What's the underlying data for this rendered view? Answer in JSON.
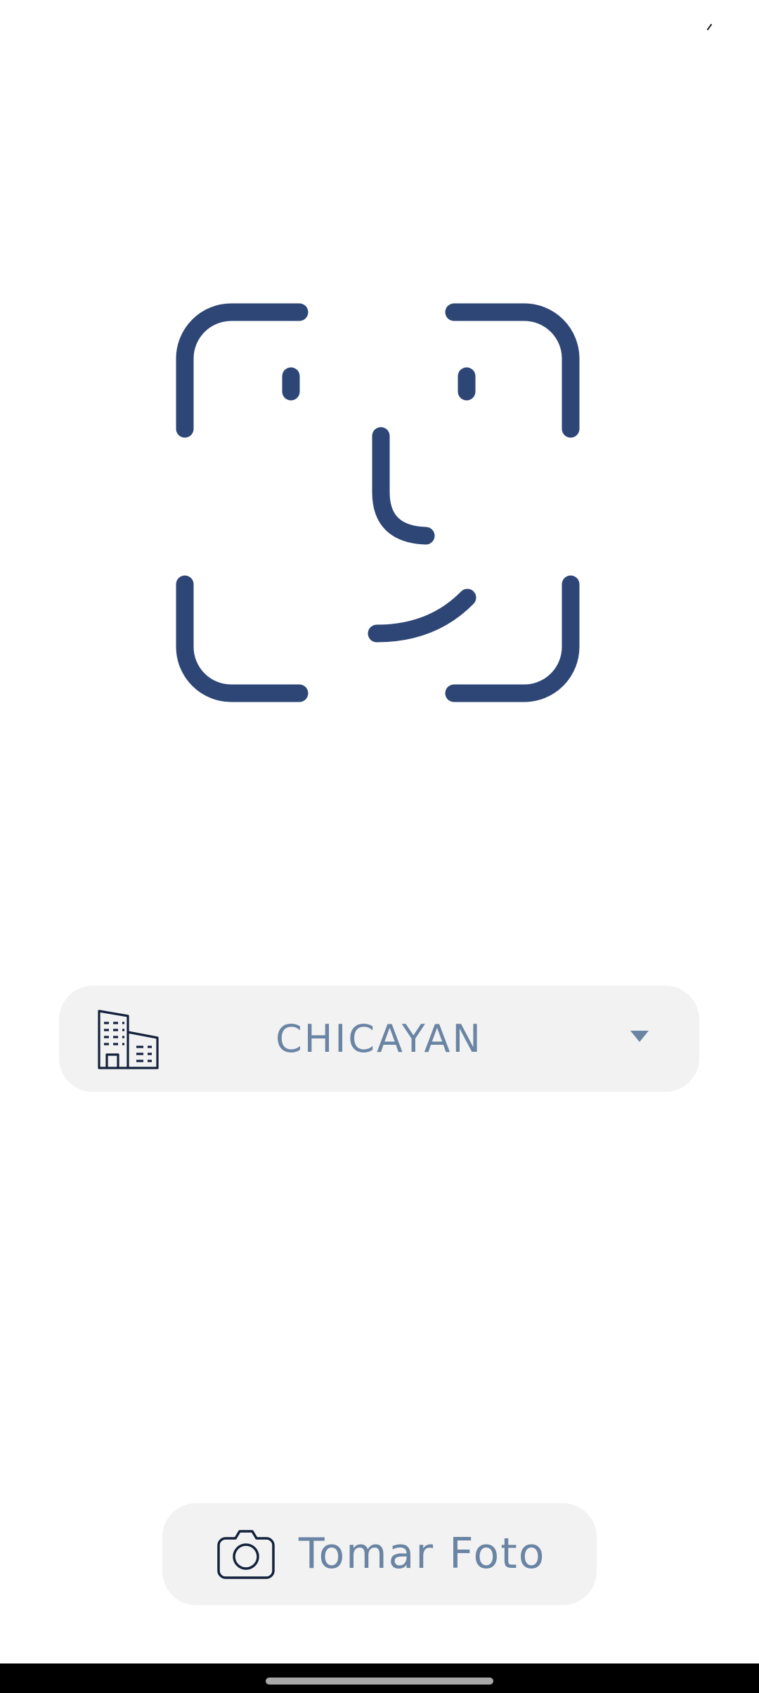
{
  "branch_selector": {
    "selected_value": "CHICAYAN",
    "icon": "building-icon",
    "dropdown_icon": "chevron-down-icon"
  },
  "take_photo_button": {
    "label": "Tomar Foto",
    "icon": "camera-icon"
  },
  "face_scan": {
    "icon": "face-id-icon"
  },
  "colors": {
    "accent": "#2e4676",
    "label_text": "#6a84a4",
    "control_bg": "#f2f2f2",
    "icon_dark": "#14213d"
  }
}
